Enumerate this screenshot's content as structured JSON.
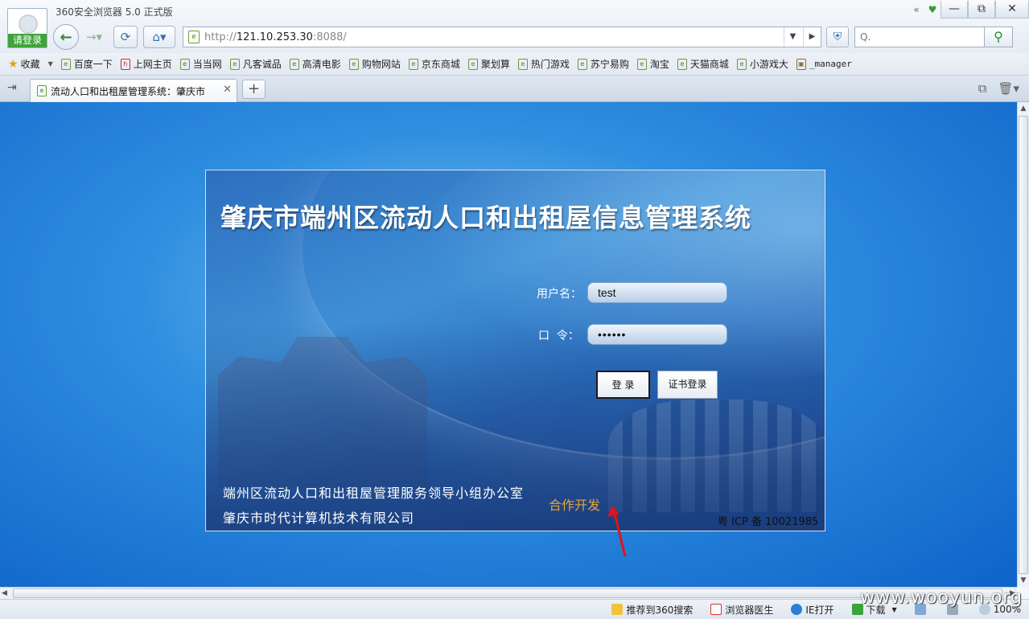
{
  "browser": {
    "title": "360安全浏览器 5.0 正式版",
    "login_label": "请登录",
    "url_prefix": "http://",
    "url_host": "121.10.253.30",
    "url_port": ":8088/",
    "search_placeholder": "Q.",
    "win_min": "—",
    "win_restore": "⧉",
    "win_close": "✕"
  },
  "favorites": {
    "collect_label": "收藏",
    "items": [
      "百度一下",
      "上网主页",
      "当当网",
      "凡客诚品",
      "高清电影",
      "购物网站",
      "京东商城",
      "聚划算",
      "热门游戏",
      "苏宁易购",
      "淘宝",
      "天猫商城",
      "小游戏大",
      "_manager"
    ]
  },
  "tabs": {
    "active_title": "流动人口和出租屋管理系统：肇庆市",
    "new_tab_label": "+"
  },
  "page": {
    "title": "肇庆市端州区流动人口和出租屋信息管理系统",
    "username_label": "用户名：",
    "username_value": "test",
    "password_label": "口  令：",
    "password_value": "••••••",
    "login_button": "登 录",
    "cert_login_button": "证书登录",
    "footer_line1": "端州区流动人口和出租屋管理服务领导小组办公室",
    "footer_line2": "肇庆市时代计算机技术有限公司",
    "cooperation": "合作开发",
    "icp": "粤 ICP 备 10021985"
  },
  "statusbar": {
    "recommend": "推荐到360搜索",
    "doctor": "浏览器医生",
    "ie_open": "IE打开",
    "download": "下载",
    "zoom": "100%"
  },
  "watermark": "www.wooyun.org",
  "colors": {
    "accent_green": "#3fa33a",
    "page_blue": "#2f8fe0",
    "annotation_red": "#e0141a"
  }
}
